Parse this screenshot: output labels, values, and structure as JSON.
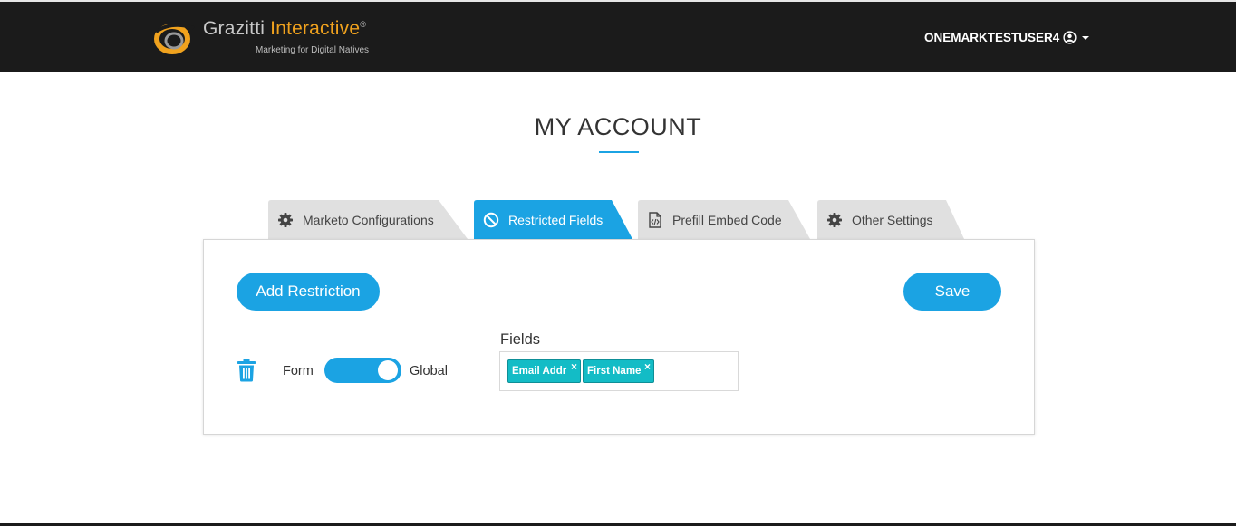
{
  "header": {
    "brand_name_first": "Grazitti",
    "brand_name_second": "Interactive",
    "brand_registered": "®",
    "brand_tagline": "Marketing for Digital Natives",
    "username": "ONEMARKTESTUSER4",
    "user_icon": "user-circle-icon",
    "menu_icon": "caret-down-icon"
  },
  "page": {
    "title": "MY ACCOUNT"
  },
  "tabs": [
    {
      "label": "Marketo Configurations",
      "icon": "gear-icon",
      "active": false
    },
    {
      "label": "Restricted Fields",
      "icon": "ban-icon",
      "active": true
    },
    {
      "label": "Prefill Embed Code",
      "icon": "code-file-icon",
      "active": false
    },
    {
      "label": "Other Settings",
      "icon": "gear-icon",
      "active": false
    }
  ],
  "panel": {
    "add_button": "Add Restriction",
    "save_button": "Save",
    "restriction": {
      "delete_icon": "trash-icon",
      "scope_left_label": "Form",
      "scope_right_label": "Global",
      "scope_selected": "Global",
      "fields_label": "Fields",
      "fields": [
        "Email Addr",
        "First Name"
      ],
      "remove_glyph": "×"
    }
  },
  "colors": {
    "accent": "#1ba3e3",
    "topbar": "#1b1b1b",
    "chip": "#13bcc6",
    "tab_inactive": "#e0e0e0",
    "brand_orange": "#f0a21e"
  }
}
